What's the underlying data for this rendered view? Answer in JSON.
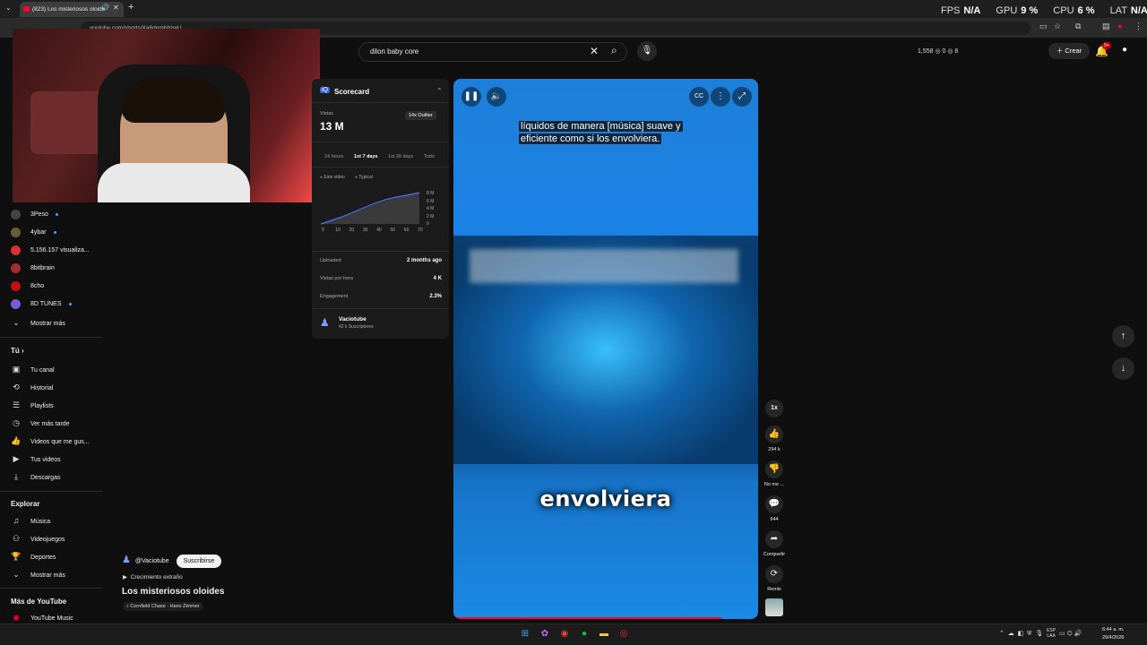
{
  "browser": {
    "tab_title": "(823) Los misteriosos oloide",
    "url": "youtube.com/shorts/Xa6dnmhbzwU"
  },
  "overlay": {
    "fps_label": "FPS",
    "fps_value": "N/A",
    "gpu_label": "GPU",
    "gpu_value": "9 %",
    "cpu_label": "CPU",
    "cpu_value": "6 %",
    "lat_label": "LAT",
    "lat_value": "N/A"
  },
  "header": {
    "search_value": "dilon baby core",
    "stats": "1,558  ◎ 0  ◎ 8",
    "create_label": "Crear",
    "notif_badge": "9+"
  },
  "sidebar": {
    "subscriptions": [
      {
        "name": "3Peso",
        "color": "#444444",
        "dot": true
      },
      {
        "name": "4ybar",
        "color": "#6b5b3a",
        "dot": true
      },
      {
        "name": "5.156.157 visualiza...",
        "color": "#d33333",
        "dot": false
      },
      {
        "name": "8bitbrain",
        "color": "#a03030",
        "dot": false
      },
      {
        "name": "8cho",
        "color": "#c01010",
        "dot": false
      },
      {
        "name": "8D TUNES",
        "color": "#7a5ad8",
        "dot": true
      }
    ],
    "show_more": "Mostrar más",
    "you_heading": "Tú",
    "you_items": [
      "Tu canal",
      "Historial",
      "Playlists",
      "Ver más tarde",
      "Videos que me gus...",
      "Tus videos",
      "Descargas"
    ],
    "explore_heading": "Explorar",
    "explore_items": [
      "Música",
      "Videojuegos",
      "Deportes",
      "Mostrar más"
    ],
    "more_heading": "Más de YouTube",
    "more_items": [
      "YouTube Music"
    ]
  },
  "scorecard": {
    "title": "Scorecard",
    "views_label": "Vistas",
    "views_value": "13 M",
    "outlier_badge": "14x Outlier",
    "tabs": [
      "24 hours",
      "1st 7 days",
      "1st 28 days",
      "Todo"
    ],
    "active_tab": "1st 7 days",
    "legend_this": "Este video",
    "legend_typical": "Typical",
    "chart_y": [
      "8 M",
      "6 M",
      "4 M",
      "2 M",
      "0"
    ],
    "chart_x": [
      "0",
      "10",
      "20",
      "30",
      "40",
      "50",
      "60",
      "70"
    ],
    "rows": [
      {
        "label": "Uploaded",
        "value": "2 months ago"
      },
      {
        "label": "Vistas por hora",
        "value": "4 K"
      },
      {
        "label": "Engagement",
        "value": "2.3%"
      }
    ],
    "channel_name": "Vaciotube",
    "channel_subs": "42 k Suscriptores"
  },
  "video": {
    "subtitle_line1": "líquidos de manera [música] suave y",
    "subtitle_line2": "eficiente como si los envolviera.",
    "caption": "envolviera",
    "progress": 0.88
  },
  "actions": {
    "speed": "1x",
    "likes": "294 k",
    "dislike": "No me ...",
    "comments": "944",
    "share": "Compartir",
    "remix": "Remix"
  },
  "meta": {
    "channel_handle": "@Vaciotube",
    "subscribe_label": "Suscribirse",
    "playlist": "Crecimiento extraño",
    "title": "Los misteriosos oloides",
    "music": "Cornfield Chase · Hans Zimmer"
  },
  "taskbar": {
    "lang_top": "ESP",
    "lang_bottom": "LAA",
    "time": "6:44 a. m.",
    "date": "29/4/2026"
  }
}
